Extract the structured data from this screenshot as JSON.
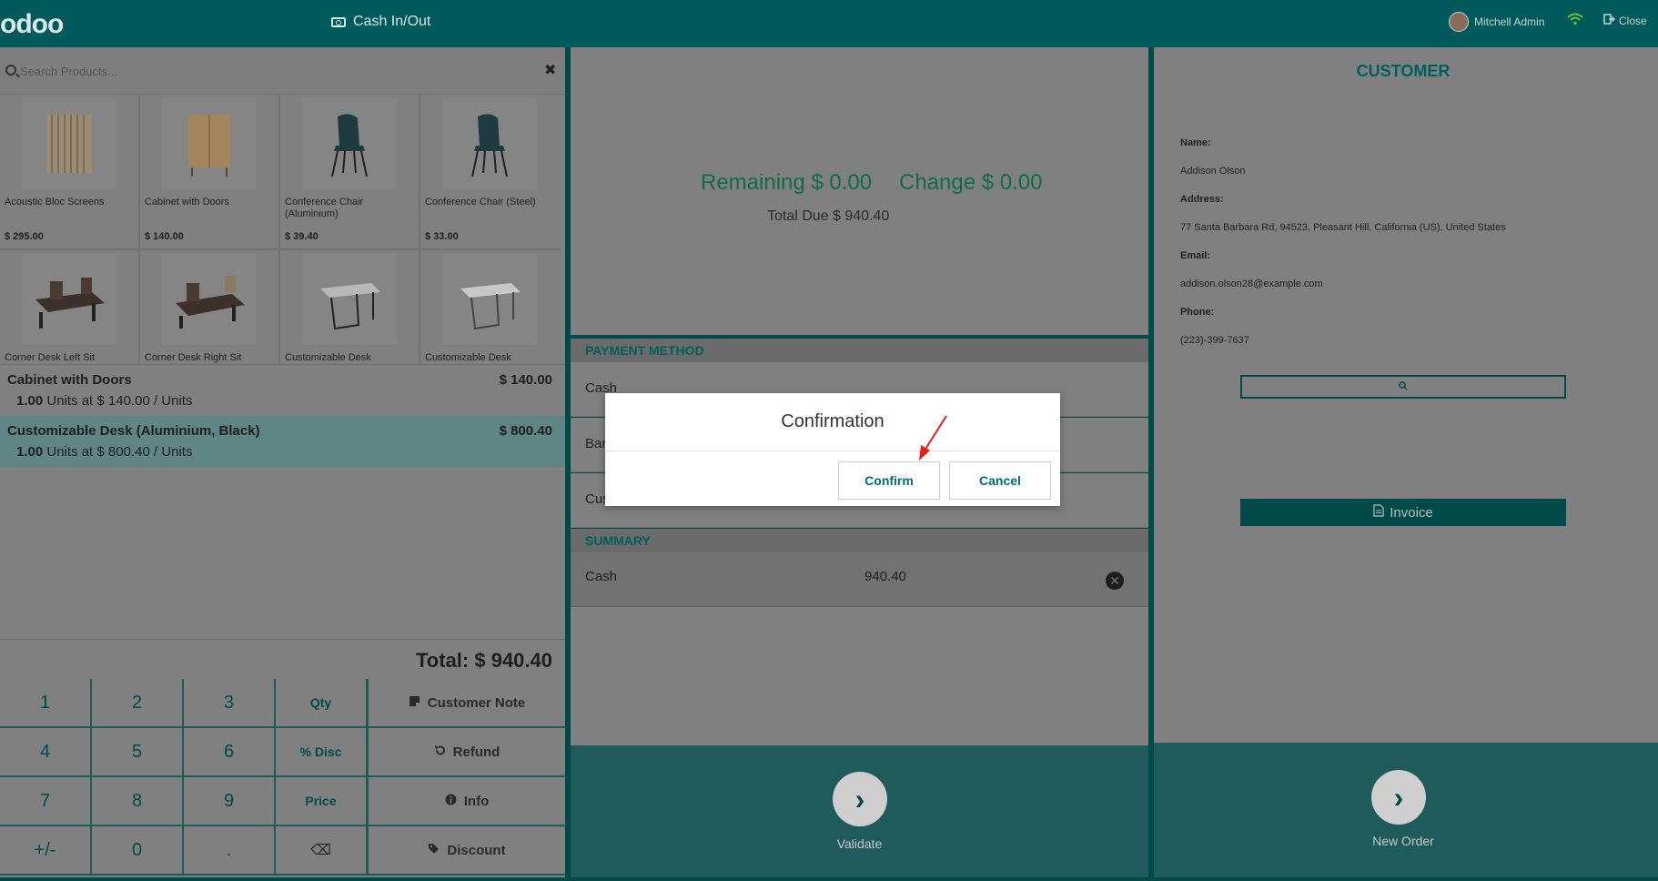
{
  "header": {
    "logo": "odoo",
    "cash_in_out": "Cash In/Out",
    "user": "Mitchell Admin",
    "close": "Close"
  },
  "search": {
    "placeholder": "Search Products..."
  },
  "products": [
    {
      "name": "Acoustic Bloc Screens",
      "price": "$ 295.00"
    },
    {
      "name": "Cabinet with Doors",
      "price": "$ 140.00"
    },
    {
      "name": "Conference Chair (Aluminium)",
      "price": "$ 39.40"
    },
    {
      "name": "Conference Chair (Steel)",
      "price": "$ 33.00"
    },
    {
      "name": "Corner Desk Left Sit",
      "price": ""
    },
    {
      "name": "Corner Desk Right Sit",
      "price": ""
    },
    {
      "name": "Customizable Desk",
      "price": ""
    },
    {
      "name": "Customizable Desk",
      "price": ""
    }
  ],
  "order_lines": [
    {
      "name": "Cabinet with Doors",
      "price": "$ 140.00",
      "qty": "1.00",
      "unit_text": "Units at $ 140.00 / Units"
    },
    {
      "name": "Customizable Desk (Aluminium, Black)",
      "price": "$ 800.40",
      "qty": "1.00",
      "unit_text": "Units at $ 800.40 / Units"
    }
  ],
  "total": "Total: $ 940.40",
  "numpad": {
    "keys": [
      "1",
      "2",
      "3",
      "Qty",
      "4",
      "5",
      "6",
      "% Disc",
      "7",
      "8",
      "9",
      "Price",
      "+/-",
      "0",
      "."
    ],
    "backspace": "⌫"
  },
  "controls": {
    "customer_note": "Customer Note",
    "refund": "Refund",
    "info": "Info",
    "discount": "Discount"
  },
  "payment": {
    "remaining": "Remaining $ 0.00",
    "change": "Change $ 0.00",
    "total_due": "Total Due  $ 940.40",
    "method_header": "PAYMENT METHOD",
    "methods": [
      "Cash",
      "Bank",
      "Customer Account"
    ],
    "summary_header": "SUMMARY",
    "summary_method": "Cash",
    "summary_amount": "940.40",
    "validate": "Validate"
  },
  "customer": {
    "title": "CUSTOMER",
    "name_label": "Name:",
    "name": "Addison Olson",
    "address_label": "Address:",
    "address": "77 Santa Barbara Rd, 94523, Pleasant Hill, California (US), United States",
    "email_label": "Email:",
    "email": "addison.olson28@example.com",
    "phone_label": "Phone:",
    "phone": "(223)-399-7637",
    "invoice": "Invoice",
    "new_order": "New Order"
  },
  "dialog": {
    "title": "Confirmation",
    "confirm": "Confirm",
    "cancel": "Cancel"
  },
  "colors": {
    "brand": "#00595a",
    "accent": "#016e6e",
    "amount_green": "#0f6b4a"
  }
}
